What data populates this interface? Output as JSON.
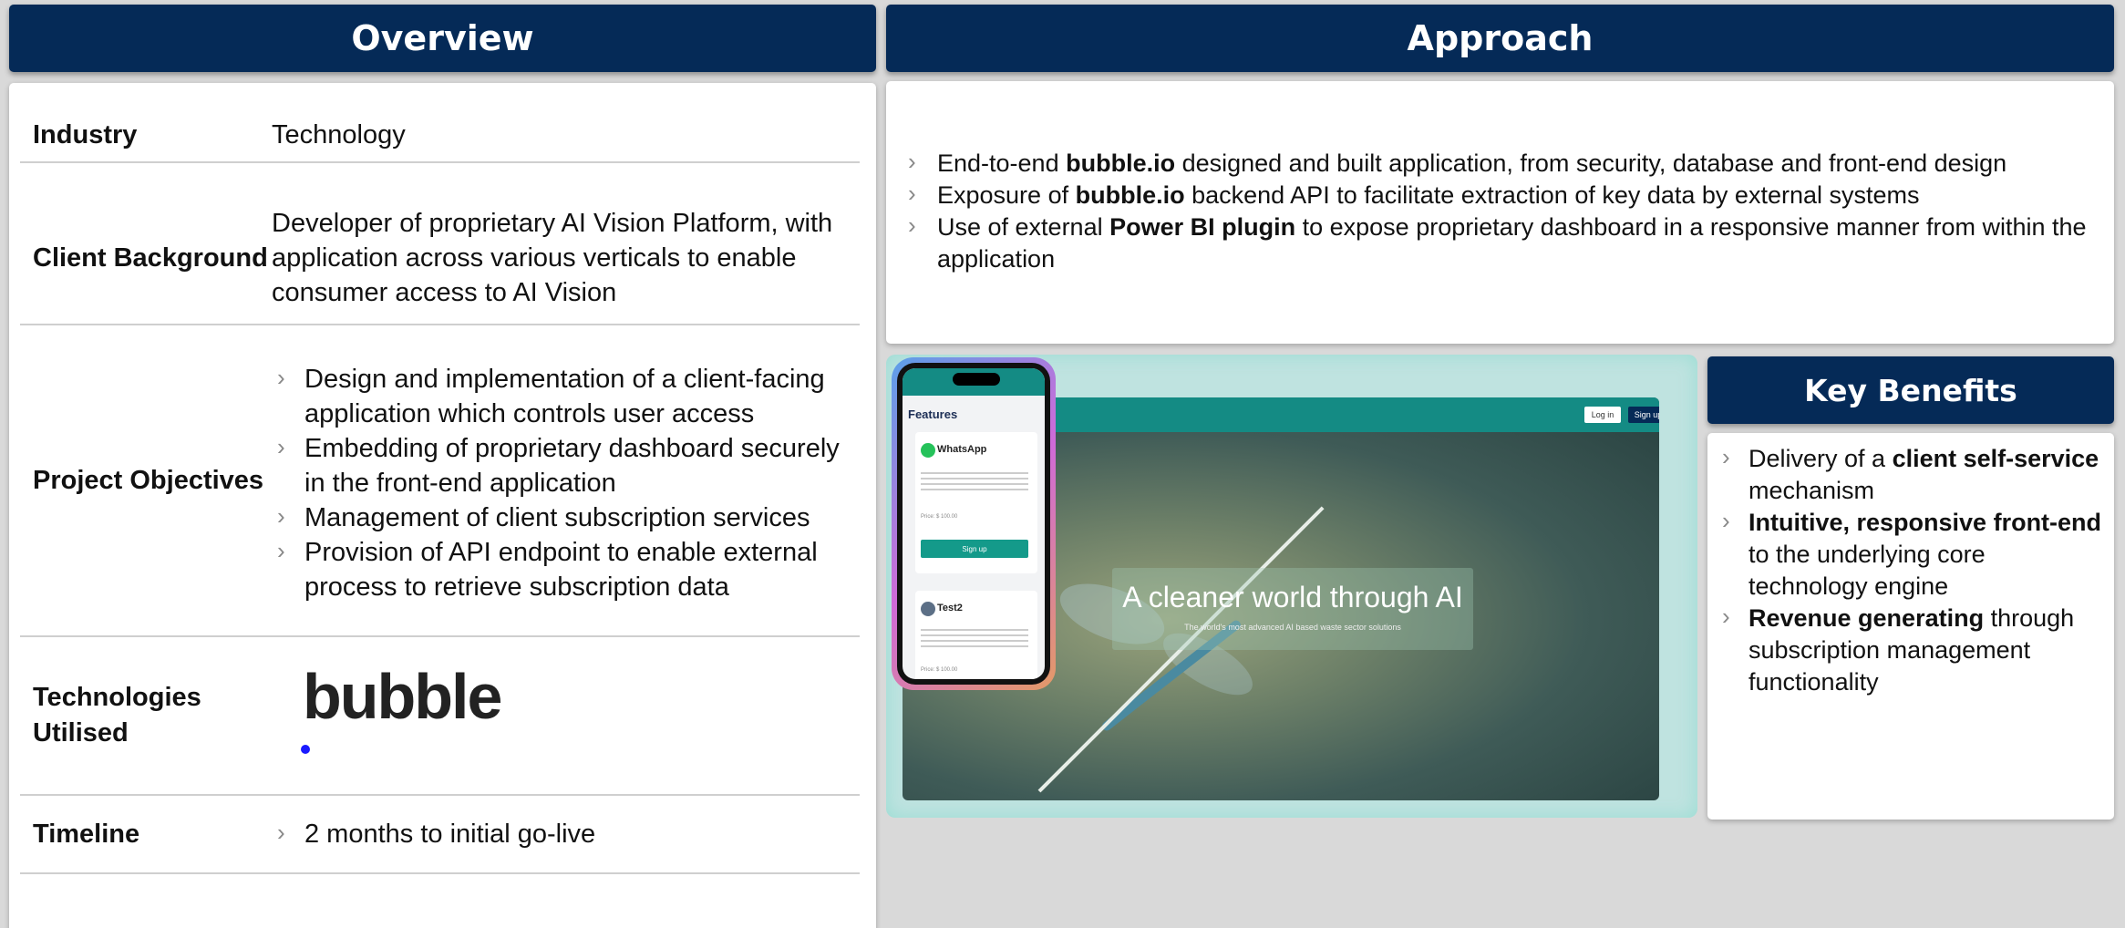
{
  "overview": {
    "title": "Overview",
    "rows": [
      {
        "label": "Industry",
        "value": "Technology"
      },
      {
        "label": "Client Background",
        "value": "Developer of proprietary AI Vision Platform, with application across various verticals to enable consumer access to AI Vision"
      },
      {
        "label": "Project Objectives",
        "items": [
          "Design and implementation of a client-facing application which controls user access",
          "Embedding of proprietary dashboard securely in the front-end application",
          "Management of client subscription services",
          "Provision of API endpoint to enable external process to retrieve subscription data"
        ]
      },
      {
        "label": "Technologies Utilised",
        "logo_text": "bubble"
      },
      {
        "label": "Timeline",
        "items": [
          "2 months to initial go-live"
        ]
      }
    ]
  },
  "approach": {
    "title": "Approach",
    "items": [
      {
        "pre": "End-to-end ",
        "bold": "bubble.io",
        "post": " designed and built application, from security, database and front-end design"
      },
      {
        "pre": "Exposure of ",
        "bold": "bubble.io",
        "post": " backend API to facilitate extraction of key data by external systems"
      },
      {
        "pre": "Use of external ",
        "bold": "Power BI plugin",
        "post": " to expose proprietary dashboard in a responsive manner from within the application"
      }
    ]
  },
  "key_benefits": {
    "title": "Key Benefits",
    "items": [
      {
        "pre": "Delivery of a ",
        "bold": "client self-service",
        "post": " mechanism"
      },
      {
        "pre": "",
        "bold": "Intuitive, responsive front-end",
        "post": " to the underlying core technology engine"
      },
      {
        "pre": "",
        "bold": "Revenue generating",
        "post": " through subscription management functionality"
      }
    ]
  },
  "screenshot": {
    "site": {
      "login": "Log in",
      "signup": "Sign up",
      "hero_title": "A cleaner world through AI",
      "hero_subtitle": "The world's most advanced AI based waste sector solutions"
    },
    "phone": {
      "features": "Features",
      "card1_title": "WhatsApp",
      "card1_price": "Price: $ 100.00",
      "card1_button": "Sign up",
      "card2_title": "Test2",
      "card2_price": "Price: $ 100.00"
    }
  },
  "colors": {
    "header": "#052a57",
    "accent_teal": "#148b84",
    "bubble_dot": "#1a1aff"
  }
}
